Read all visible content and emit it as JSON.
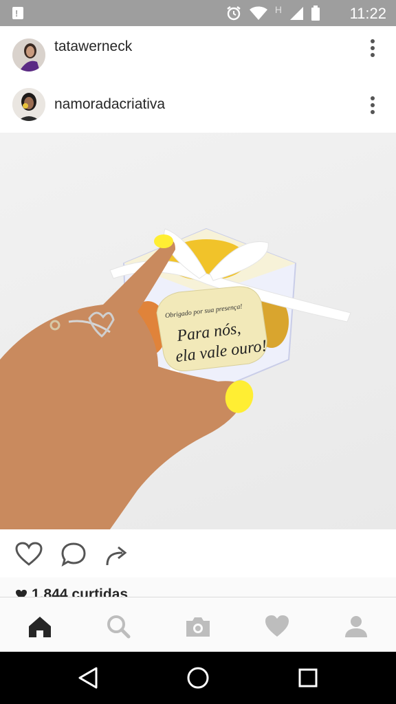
{
  "status_bar": {
    "time": "11:22",
    "network_label": "H",
    "icons": [
      "notification-icon",
      "alarm-icon",
      "wifi-icon",
      "signal-icon",
      "battery-icon"
    ]
  },
  "posts": [
    {
      "username": "tatawerneck"
    },
    {
      "username": "namoradacriativa"
    }
  ],
  "photo": {
    "tag_small": "Obrigado por sua presença!",
    "tag_line1": "Para nós,",
    "tag_line2": "ela vale ouro!"
  },
  "likes": "1.844 curtidas",
  "tabs": [
    "home-icon",
    "search-icon",
    "camera-icon",
    "activity-heart-icon",
    "profile-icon"
  ],
  "nav": [
    "back-icon",
    "home-circle-icon",
    "recents-icon"
  ],
  "colors": {
    "status_bar": "#9e9e9e",
    "nail_yellow": "#ffee33",
    "tag": "#f2e9b9"
  }
}
